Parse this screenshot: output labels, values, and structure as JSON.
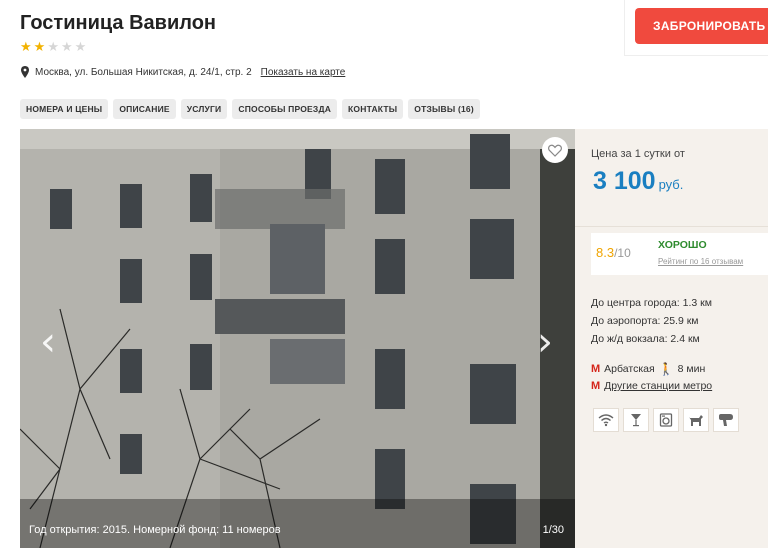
{
  "hotel": {
    "title": "Гостиница Вавилон",
    "stars_filled": 2,
    "stars_total": 5,
    "address": "Москва, ул. Большая Никитская, д. 24/1, стр. 2",
    "map_link": "Показать на карте"
  },
  "header": {
    "book_label": "ЗАБРОНИРОВАТЬ"
  },
  "tabs": [
    {
      "label": "НОМЕРА И ЦЕНЫ"
    },
    {
      "label": "ОПИСАНИЕ"
    },
    {
      "label": "УСЛУГИ"
    },
    {
      "label": "СПОСОБЫ ПРОЕЗДА"
    },
    {
      "label": "КОНТАКТЫ"
    },
    {
      "label": "ОТЗЫВЫ (16)"
    }
  ],
  "gallery": {
    "caption": "Год открытия: 2015. Номерной фонд: 11 номеров",
    "counter": "1/30"
  },
  "side": {
    "price_label": "Цена за 1 сутки от",
    "price": "3 100",
    "currency": "руб.",
    "rating": {
      "score": "8.3",
      "outof": "/10",
      "verdict": "ХОРОШО",
      "reviews": "Рейтинг по 16 отзывам"
    },
    "distances": [
      "До центра города: 1.3 км",
      "До аэропорта: 25.9 км",
      "До ж/д вокзала: 2.4 км"
    ],
    "metro": {
      "station": "Арбатская",
      "walk": "8 мин",
      "other": "Другие станции метро"
    },
    "amenities": [
      "wifi-icon",
      "bar-icon",
      "washing-machine-icon",
      "pets-icon",
      "hairdryer-icon"
    ]
  },
  "colors": {
    "accent": "#f04a3e",
    "price": "#1a7fc1",
    "rating": "#f0a400",
    "verdict": "#2e8b2e",
    "metro": "#d5261b"
  }
}
